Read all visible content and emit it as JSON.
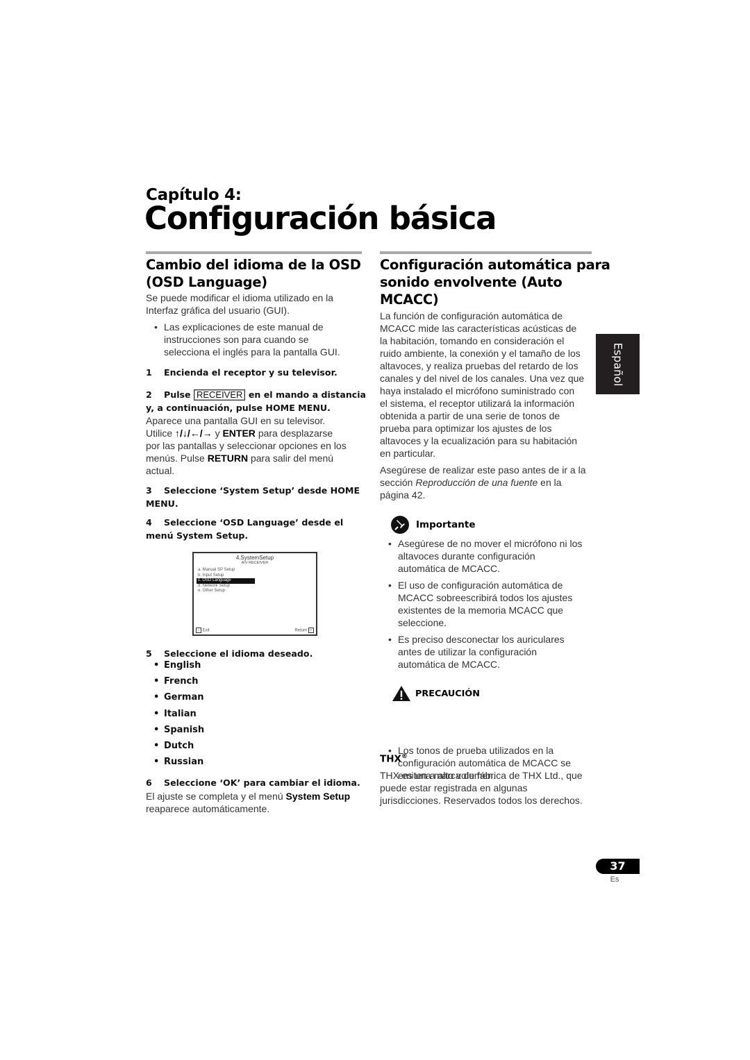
{
  "chapter": {
    "label": "Capítulo 4:",
    "title": "Configuración básica"
  },
  "left": {
    "heading_line1": "Cambio del idioma de la OSD",
    "heading_line2": "(OSD Language)",
    "intro_line1": "Se puede modificar el idioma utilizado en la",
    "intro_line2": "Interfaz gráfica del usuario (GUI).",
    "note_lines": [
      "Las explicaciones de este manual de",
      "instrucciones son para cuando se",
      "selecciona el inglés para la pantalla GUI."
    ],
    "step1": {
      "num": "1",
      "text": "Encienda el receptor y su televisor."
    },
    "step2": {
      "num": "2",
      "pre": "Pulse",
      "key": "RECEIVER",
      "post": "en el mando a distancia",
      "line2": "y, a continuación, pulse HOME MENU.",
      "body_line1": "Aparece una pantalla GUI en su televisor.",
      "body_line2_pre": "Utilice",
      "arrows": "↑/↓/←/→",
      "body_line2_mid": "y",
      "enter": "ENTER",
      "body_line2_post": "para desplazarse",
      "body_line3": "por las pantallas y seleccionar opciones en los",
      "body_line4_pre": "menús. Pulse",
      "return": "RETURN",
      "body_line4_post": "para salir del menú",
      "body_line5": "actual."
    },
    "step3": {
      "num": "3",
      "line1": "Seleccione ‘System Setup’ desde HOME",
      "line2": "MENU."
    },
    "step4": {
      "num": "4",
      "line1": "Seleccione ‘OSD Language’ desde el",
      "line2": "menú System Setup."
    },
    "osd_screen": {
      "title": "4.SystemSetup",
      "subtitle": "A/V RECEIVER",
      "items": [
        "a. Manual SP Setup",
        "b. Input Setup",
        "c. OSD Language",
        "d. Network Setup",
        "e. Other Setup"
      ],
      "selected_index": 2,
      "exit_label": "Exit",
      "return_label": "Return"
    },
    "step5": {
      "num": "5",
      "text": "Seleccione el idioma deseado."
    },
    "languages": [
      "English",
      "French",
      "German",
      "Italian",
      "Spanish",
      "Dutch",
      "Russian"
    ],
    "step6": {
      "num": "6",
      "text": "Seleccione ‘OK’ para cambiar el idioma.",
      "body_pre": "El ajuste se completa y el menú",
      "body_bold": "System Setup",
      "body_line2": "reaparece automáticamente."
    }
  },
  "right": {
    "heading_lines": [
      "Configuración automática para",
      "sonido envolvente (Auto",
      "MCACC)"
    ],
    "para1_lines": [
      "La función de configuración automática de",
      "MCACC mide las características acústicas de",
      "la habitación, tomando en consideración el",
      "ruido ambiente, la conexión y el tamaño de los",
      "altavoces, y realiza pruebas del retardo de los",
      "canales y del nivel de los canales. Una vez que",
      "haya instalado el micrófono suministrado con",
      "el sistema, el receptor utilizará la información",
      "obtenida a partir de una serie de tonos de",
      "prueba para optimizar los ajustes de los",
      "altavoces y la ecualización para su habitación",
      "en particular."
    ],
    "para2_line1": "Asegúrese de realizar este paso antes de ir a la",
    "para2_line2_pre": "sección",
    "para2_link": "Reproducción de una fuente",
    "para2_line2_post": "en la",
    "para2_line3": "página 42.",
    "important": {
      "label": "Importante",
      "bullets": [
        [
          "Asegúrese de no mover el micrófono ni los",
          "altavoces durante configuración",
          "automática de MCACC."
        ],
        [
          "El uso de configuración automática de",
          "MCACC sobreescribirá todos los ajustes",
          "existentes de la memoria MCACC que",
          "seleccione."
        ],
        [
          "Es preciso desconectar los auriculares",
          "antes de utilizar la configuración",
          "automática de MCACC."
        ]
      ]
    },
    "caution": {
      "label": "PRECAUCIÓN",
      "bullets": [
        [
          "Los tonos de prueba utilizados en la",
          "configuración automática de MCACC se",
          "emiten a alto volumen."
        ]
      ]
    },
    "thx": {
      "heading": "THX",
      "reg": "®",
      "lines": [
        "THX es una marca de fábrica de THX Ltd., que",
        "puede estar registrada en algunas",
        "jurisdicciones. Reservados todos los derechos."
      ]
    }
  },
  "side_tab": {
    "label": "Español"
  },
  "footer": {
    "page_number": "37",
    "lang_code": "Es"
  },
  "icons": {
    "bullet": "•",
    "important": "important-pin-icon",
    "caution": "warning-triangle-icon"
  }
}
